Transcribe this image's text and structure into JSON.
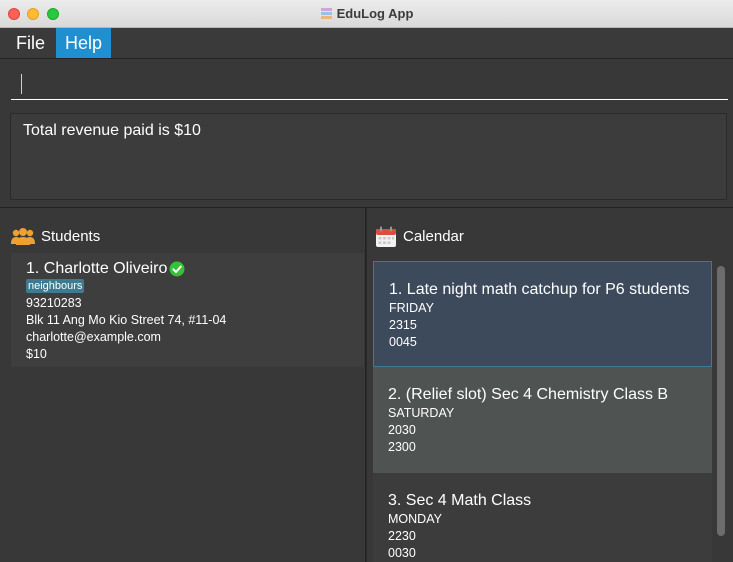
{
  "window": {
    "title": "EduLog App",
    "app_icon": "edulog-app-icon"
  },
  "menu": {
    "items": [
      {
        "label": "File"
      },
      {
        "label": "Help"
      }
    ],
    "active": "Help"
  },
  "command": {
    "value": "",
    "placeholder": ""
  },
  "result": {
    "text": "Total revenue paid is $10"
  },
  "students_panel": {
    "title": "Students",
    "icon": "students-group-icon",
    "students": [
      {
        "name": "1. Charlotte Oliveiro",
        "paid_icon": "paid-check-icon",
        "tags": [
          "neighbours"
        ],
        "phone": "93210283",
        "address": "Blk 11 Ang Mo Kio Street 74, #11-04",
        "email": "charlotte@example.com",
        "fee": "$10"
      }
    ]
  },
  "calendar_panel": {
    "title": "Calendar",
    "icon": "calendar-icon",
    "lessons": [
      {
        "title": "1. Late night math catchup for P6 students",
        "day": "FRIDAY",
        "start": "2315",
        "end": "0045"
      },
      {
        "title": "2. (Relief slot) Sec 4 Chemistry Class B",
        "day": "SATURDAY",
        "start": "2030",
        "end": "2300"
      },
      {
        "title": "3. Sec 4 Math Class",
        "day": "MONDAY",
        "start": "2230",
        "end": "0030"
      }
    ]
  },
  "colors": {
    "accent": "#1f8fcf",
    "tag": "#3e7b91",
    "paid": "#35c235",
    "students_icon": "#f0a030",
    "calendar_icon": "#e04b3f"
  }
}
